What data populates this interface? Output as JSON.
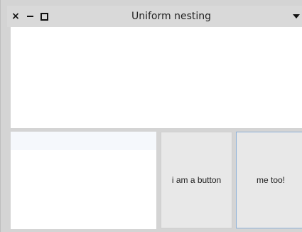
{
  "window": {
    "title": "Uniform nesting",
    "close_glyph": "×"
  },
  "icons": {
    "close": "close-icon",
    "minimize": "minimize-icon",
    "maximize": "maximize-icon",
    "menu": "chevron-down-icon"
  },
  "buttons": {
    "first_label": "i am a button",
    "second_label": "me too!"
  },
  "colors": {
    "focused_border": "#8bb0d8",
    "button_bg": "#e8e8e8",
    "pane_bg": "#ffffff"
  }
}
